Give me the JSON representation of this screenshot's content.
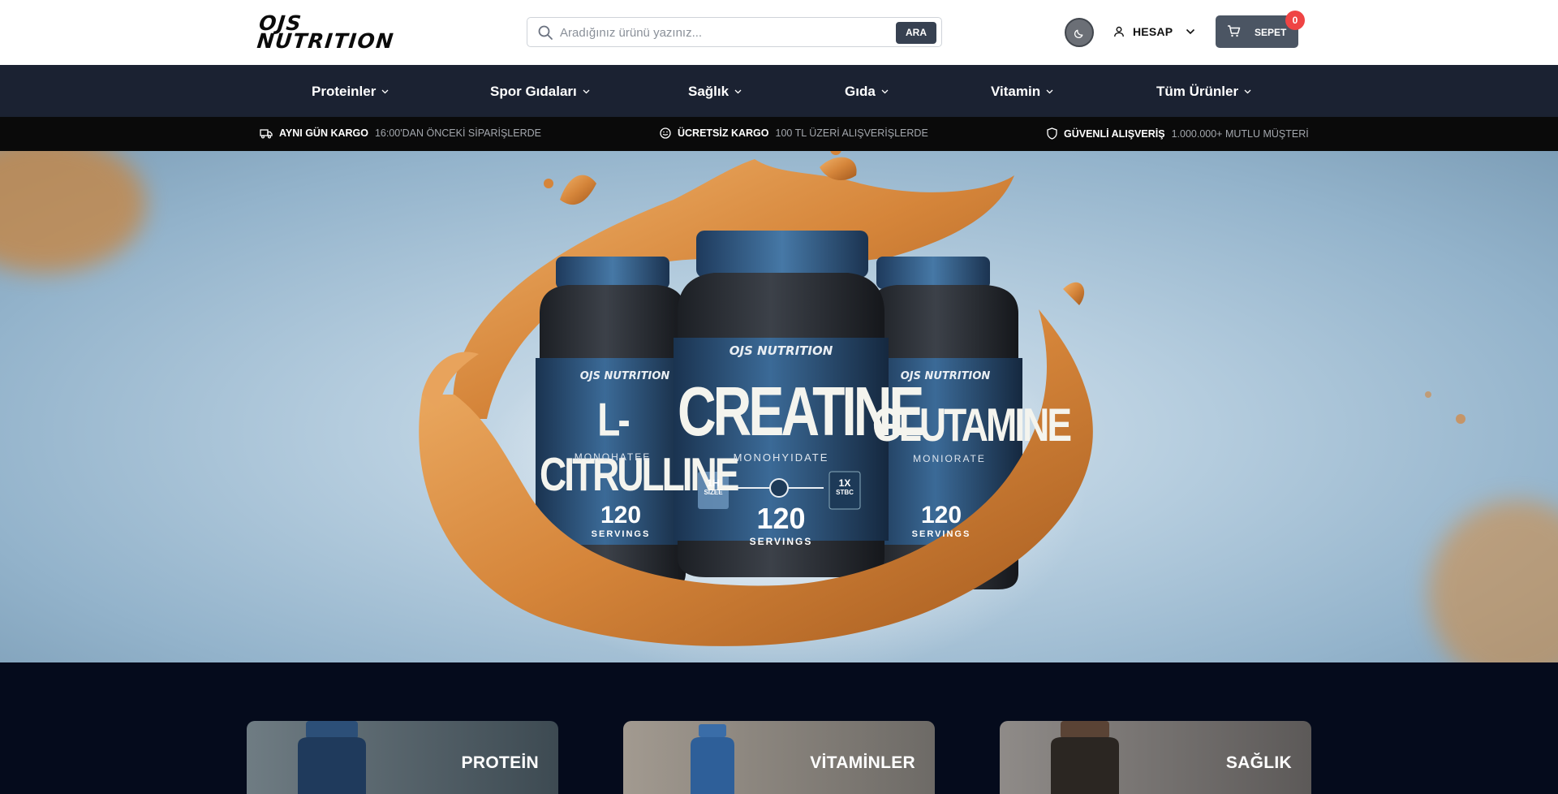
{
  "brand": {
    "logo_line1": "OJS",
    "logo_line2": "NUTRITION"
  },
  "search": {
    "placeholder": "Aradığınız ürünü yazınız...",
    "button_label": "ARA"
  },
  "header": {
    "account_label": "HESAP",
    "cart_label": "SEPET",
    "cart_count": "0"
  },
  "nav": {
    "items": [
      {
        "label": "Proteinler"
      },
      {
        "label": "Spor Gıdaları"
      },
      {
        "label": "Sağlık"
      },
      {
        "label": "Gıda"
      },
      {
        "label": "Vitamin"
      },
      {
        "label": "Tüm Ürünler"
      }
    ]
  },
  "infobar": [
    {
      "title": "AYNI GÜN KARGO",
      "subtitle": "16:00'DAN ÖNCEKİ SİPARİŞLERDE",
      "icon": "truck-icon"
    },
    {
      "title": "ÜCRETSİZ KARGO",
      "subtitle": "100 TL ÜZERİ ALIŞVERİŞLERDE",
      "icon": "smile-icon"
    },
    {
      "title": "GÜVENLİ ALIŞVERİŞ",
      "subtitle": "1.000.000+ MUTLU MÜŞTERİ",
      "icon": "shield-icon"
    }
  ],
  "hero": {
    "products": [
      {
        "brand": "OJS NUTRITION",
        "name": "L-CITRULLINE",
        "sub": "MONOHATEE",
        "servings": "120",
        "servings_label": "SERVINGS"
      },
      {
        "brand": "OJS NUTRITION",
        "name": "CREATINE",
        "sub": "MONOHYIDATE",
        "servings": "120",
        "servings_label": "SERVINGS",
        "left_badge_top": "1H",
        "left_badge_bottom": "SIZEE",
        "right_badge_top": "1X",
        "right_badge_bottom": "STBC"
      },
      {
        "brand": "OJS NUTRITION",
        "name": "GLUTAMINE",
        "sub": "MONIORATE",
        "servings": "120",
        "servings_label": "SERVINGS"
      }
    ]
  },
  "categories": [
    {
      "title": "PROTEİN"
    },
    {
      "title": "VİTAMİNLER"
    },
    {
      "title": "SAĞLIK"
    }
  ],
  "colors": {
    "header_bg": "#ffffff",
    "nav_bg": "#1b2232",
    "infobar_bg": "#0a0a0a",
    "page_bg": "#050b1c",
    "accent_caramel": "#d98a3a",
    "jar_blue": "#2c5a86",
    "badge_red": "#ef4444"
  }
}
